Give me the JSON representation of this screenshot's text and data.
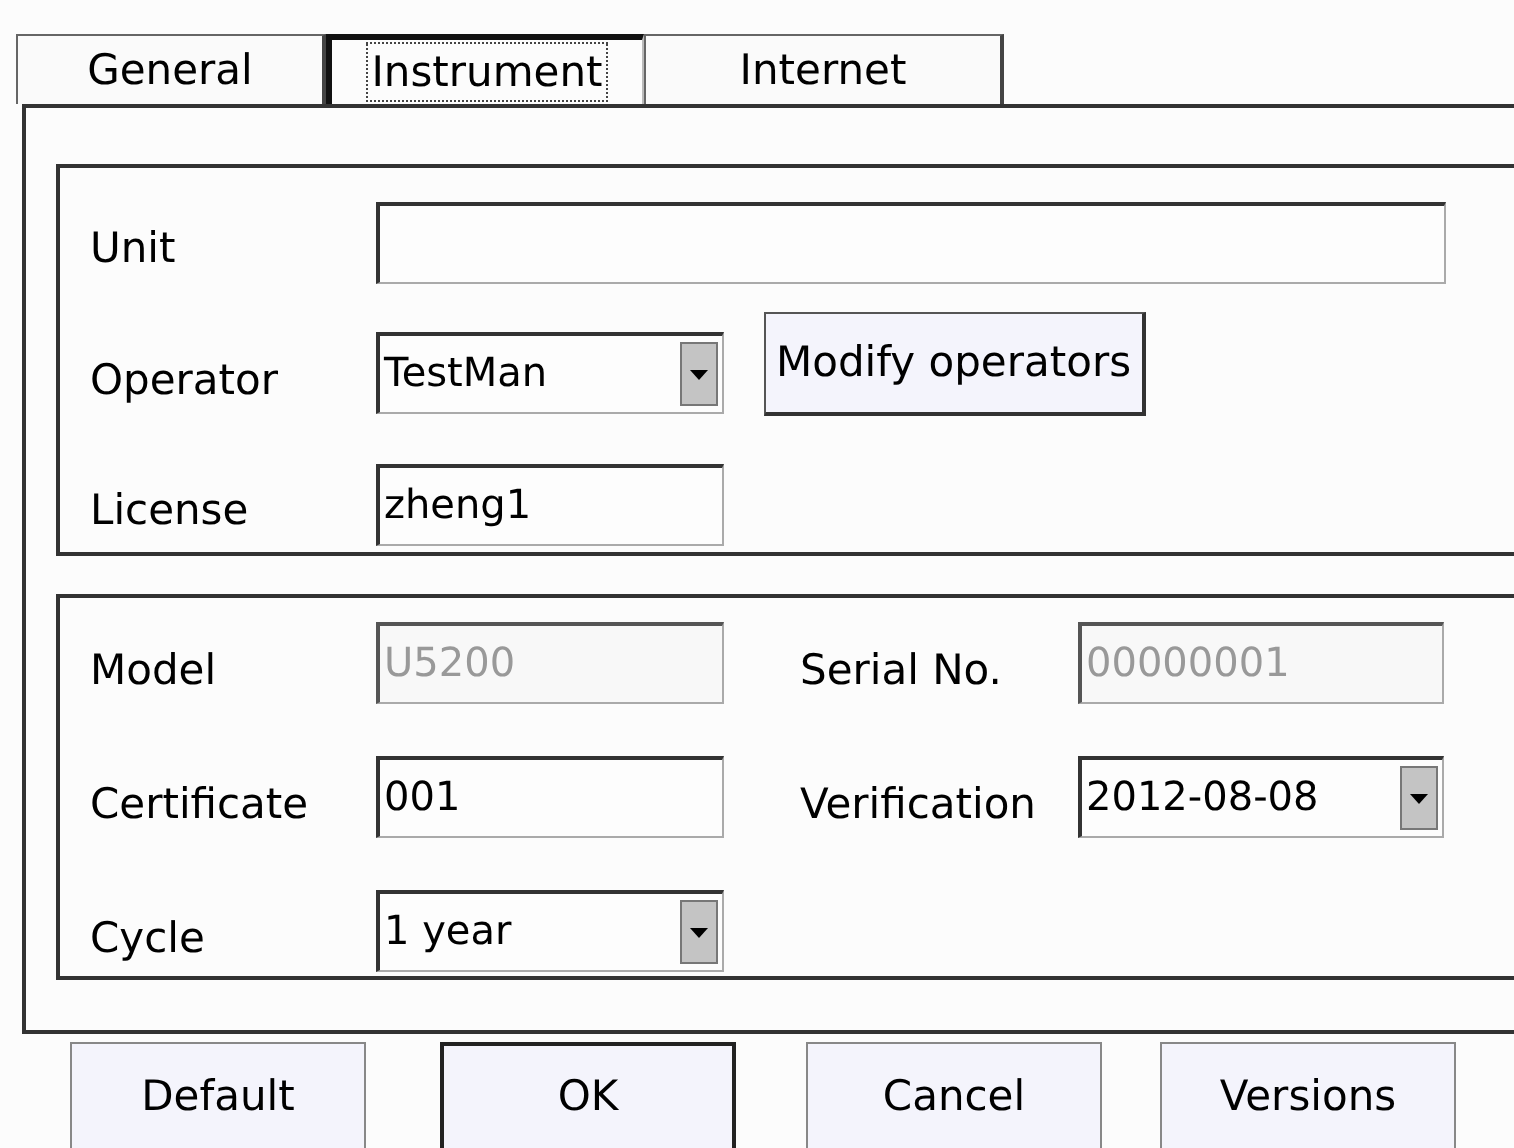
{
  "tabs": [
    {
      "label": "General",
      "selected": false
    },
    {
      "label": "Instrument",
      "selected": true
    },
    {
      "label": "Internet",
      "selected": false
    }
  ],
  "owner_group": {
    "unit": {
      "label": "Unit",
      "kind": "text",
      "disabled": false
    },
    "operator": {
      "label": "Operator",
      "kind": "combo",
      "value": "TestMan",
      "disabled": false
    },
    "modify_button": "Modify operators",
    "license": {
      "label": "License",
      "kind": "text",
      "value": "zheng1",
      "disabled": false
    }
  },
  "instrument_group": {
    "fields": [
      {
        "label": "Model",
        "kind": "text",
        "value": "U5200",
        "disabled": true
      },
      {
        "label": "Serial No.",
        "kind": "text",
        "value": "00000001",
        "disabled": true
      },
      {
        "label": "Certificate",
        "kind": "text",
        "value": "001",
        "disabled": false
      },
      {
        "label": "Verification",
        "kind": "combo",
        "value": "2012-08-08",
        "disabled": false
      },
      {
        "label": "Cycle",
        "kind": "combo",
        "value": "1 year",
        "disabled": false
      }
    ]
  },
  "buttons": [
    {
      "label": "Default",
      "default": false
    },
    {
      "label": "OK",
      "default": true
    },
    {
      "label": "Cancel",
      "default": false
    },
    {
      "label": "Versions",
      "default": false
    }
  ]
}
